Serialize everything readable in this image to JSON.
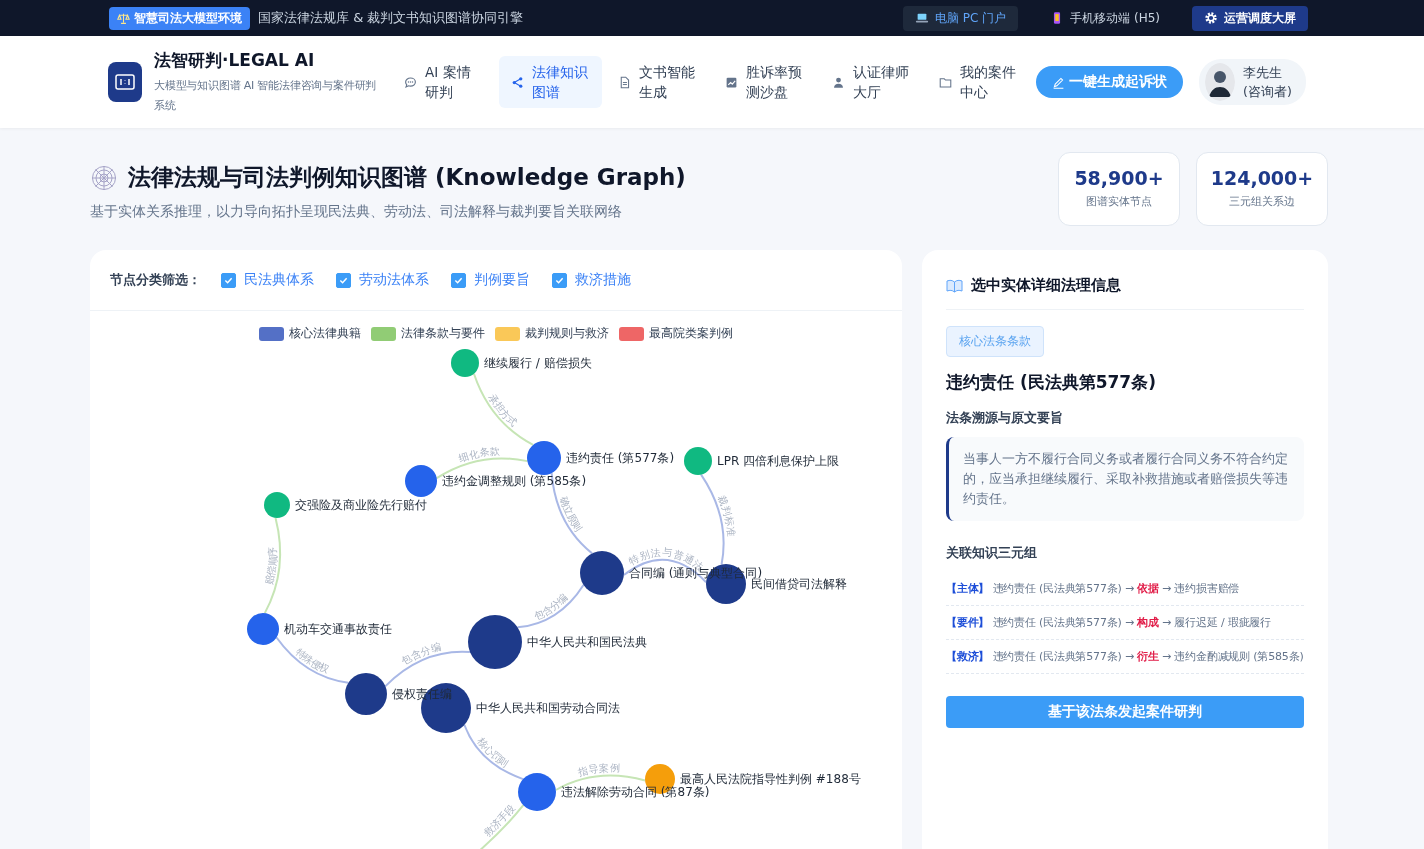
{
  "top_bar": {
    "badge": "智慧司法大模型环境",
    "tagline": "国家法律法规库 & 裁判文书知识图谱协同引擎",
    "links": [
      {
        "label": "电脑 PC 门户",
        "kind": "active"
      },
      {
        "label": "手机移动端 (H5)",
        "kind": "plain"
      },
      {
        "label": "运营调度大屏",
        "kind": "primary"
      }
    ]
  },
  "header": {
    "brand": {
      "title": "法智研判·LEGAL AI",
      "subtitle": "大模型与知识图谱 AI 智能法律咨询与案件研判系统"
    },
    "nav": [
      {
        "label": "AI 案情研判",
        "kind": "chat",
        "selected": false
      },
      {
        "label": "法律知识图谱",
        "kind": "share",
        "selected": true
      },
      {
        "label": "文书智能生成",
        "kind": "doc",
        "selected": false
      },
      {
        "label": "胜诉率预测沙盘",
        "kind": "chart",
        "selected": false
      },
      {
        "label": "认证律师大厅",
        "kind": "person",
        "selected": false
      },
      {
        "label": "我的案件中心",
        "kind": "folder",
        "selected": false
      }
    ],
    "cta": "一键生成起诉状",
    "user": {
      "name": "李先生",
      "role": "(咨询者)"
    }
  },
  "page": {
    "title": "法律法规与司法判例知识图谱 (Knowledge Graph)",
    "subtitle": "基于实体关系推理，以力导向拓扑呈现民法典、劳动法、司法解释与裁判要旨关联网络",
    "stats": [
      {
        "value": "58,900+",
        "label": "图谱实体节点"
      },
      {
        "value": "124,000+",
        "label": "三元组关系边"
      }
    ]
  },
  "graph_panel": {
    "filter_label": "节点分类筛选：",
    "filters": [
      {
        "label": "民法典体系",
        "checked": true
      },
      {
        "label": "劳动法体系",
        "checked": true
      },
      {
        "label": "判例要旨",
        "checked": true
      },
      {
        "label": "救济措施",
        "checked": true
      }
    ],
    "legend": [
      {
        "label": "核心法律典籍",
        "color": "#5470c6"
      },
      {
        "label": "法律条款与要件",
        "color": "#91cc75"
      },
      {
        "label": "裁判规则与救济",
        "color": "#fac858"
      },
      {
        "label": "最高院类案判例",
        "color": "#ee6666"
      }
    ],
    "nodes": [
      {
        "label": "继续履行 / 赔偿损失",
        "color": "#10b981"
      },
      {
        "label": "违约责任 (第577条)",
        "color": "#2563eb"
      },
      {
        "label": "违约金调整规则 (第585条)",
        "color": "#2563eb"
      },
      {
        "label": "LPR 四倍利息保护上限",
        "color": "#10b981"
      },
      {
        "label": "交强险及商业险先行赔付",
        "color": "#10b981"
      },
      {
        "label": "合同编 (通则与典型合同)",
        "color": "#1e3a8a"
      },
      {
        "label": "民间借贷司法解释",
        "color": "#1e3a8a"
      },
      {
        "label": "机动车交通事故责任",
        "color": "#2563eb"
      },
      {
        "label": "中华人民共和国民法典",
        "color": "#1e3a8a"
      },
      {
        "label": "侵权责任编",
        "color": "#1e3a8a"
      },
      {
        "label": "中华人民共和国劳动合同法",
        "color": "#1e3a8a"
      },
      {
        "label": "违法解除劳动合同 (第87条)",
        "color": "#2563eb"
      },
      {
        "label": "最高人民法院指导性判例 #188号",
        "color": "#f59e0b"
      }
    ],
    "edges": [
      {
        "label": "承担方式",
        "color": "#c6e5b5"
      },
      {
        "label": "细化条款",
        "color": "#c6e5b5"
      },
      {
        "label": "确立原则",
        "color": "#a9b8e6"
      },
      {
        "label": "裁判标准",
        "color": "#a9b8e6"
      },
      {
        "label": "特别法与普通法",
        "color": "#a9b8e6"
      },
      {
        "label": "包含分编",
        "color": "#a9b8e6"
      },
      {
        "label": "赔偿顺序",
        "color": "#c6e5b5"
      },
      {
        "label": "特殊侵权",
        "color": "#a9b8e6"
      },
      {
        "label": "包含分编",
        "color": "#a9b8e6"
      },
      {
        "label": "核心罚则",
        "color": "#a9b8e6"
      },
      {
        "label": "指导案例",
        "color": "#c6e5b5"
      },
      {
        "label": "救济手段",
        "color": "#c6e5b5"
      }
    ]
  },
  "detail_panel": {
    "title": "选中实体详细法理信息",
    "tag": "核心法条条款",
    "entity": "违约责任 (民法典第577条)",
    "source_heading": "法条溯源与原文要旨",
    "source_text": "当事人一方不履行合同义务或者履行合同义务不符合约定的，应当承担继续履行、采取补救措施或者赔偿损失等违约责任。",
    "triples_heading": "关联知识三元组",
    "triples": [
      {
        "tag": "【主体】",
        "subject": "违约责任 (民法典第577条)",
        "arrow_1": "→",
        "relation": "依据",
        "arrow_2": "→",
        "object": "违约损害赔偿"
      },
      {
        "tag": "【要件】",
        "subject": "违约责任 (民法典第577条)",
        "arrow_1": "→",
        "relation": "构成",
        "arrow_2": "→",
        "object": "履行迟延 / 瑕疵履行"
      },
      {
        "tag": "【救济】",
        "subject": "违约责任 (民法典第577条)",
        "arrow_1": "→",
        "relation": "衍生",
        "arrow_2": "→",
        "object": "违约金酌减规则 (第585条)"
      }
    ],
    "action": "基于该法条发起案件研判"
  }
}
